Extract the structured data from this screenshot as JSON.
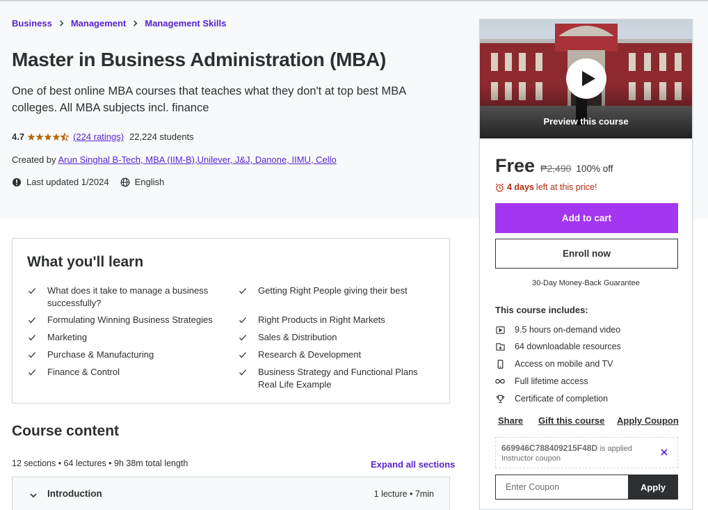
{
  "breadcrumb": [
    "Business",
    "Management",
    "Management Skills"
  ],
  "course": {
    "title": "Master in Business Administration (MBA)",
    "subtitle": "One of best online MBA courses that teaches what they don't at top best MBA colleges. All MBA subjects incl. finance",
    "rating": "4.7",
    "rating_value": 4.7,
    "rating_max": 5,
    "ratings_count": "(224 ratings)",
    "students": "22,224 students",
    "created_by_label": "Created by",
    "instructor": "Arun Singhal B-Tech, MBA (IIM-B),Unilever, J&J, Danone, IIMU, Cello",
    "last_updated": "Last updated 1/2024",
    "language": "English"
  },
  "learn": {
    "title": "What you'll learn",
    "items_left": [
      "What does it take to manage a business successfully?",
      "Formulating Winning Business Strategies",
      "Marketing",
      "Purchase & Manufacturing",
      "Finance & Control"
    ],
    "items_right": [
      "Getting Right People giving their best",
      "Right Products in Right Markets",
      "Sales & Distribution",
      "Research & Development",
      "Business Strategy and Functional Plans Real Life Example"
    ]
  },
  "content": {
    "title": "Course content",
    "meta": "12 sections • 64 lectures • 9h 38m total length",
    "expand_label": "Expand all sections",
    "sections": [
      {
        "title": "Introduction",
        "meta": "1 lecture • 7min"
      }
    ]
  },
  "sidebar": {
    "preview_label": "Preview this course",
    "price": "Free",
    "original_price": "₱2,490",
    "discount": "100% off",
    "deadline_bold": "4 days",
    "deadline_rest": "left at this price!",
    "add_to_cart": "Add to cart",
    "enroll": "Enroll now",
    "guarantee": "30-Day Money-Back Guarantee",
    "includes_title": "This course includes:",
    "includes": [
      {
        "icon": "video-icon",
        "text": "9.5 hours on-demand video"
      },
      {
        "icon": "download-icon",
        "text": "64 downloadable resources"
      },
      {
        "icon": "mobile-icon",
        "text": "Access on mobile and TV"
      },
      {
        "icon": "infinity-icon",
        "text": "Full lifetime access"
      },
      {
        "icon": "trophy-icon",
        "text": "Certificate of completion"
      }
    ],
    "links": [
      "Share",
      "Gift this course",
      "Apply Coupon"
    ],
    "coupon_code": "669946C788409215F48D",
    "coupon_applied": "is applied",
    "coupon_type": "Instructor coupon",
    "coupon_placeholder": "Enter Coupon",
    "apply_label": "Apply"
  },
  "colors": {
    "accent": "#a435f0",
    "link": "#5624d0",
    "star": "#b4690e",
    "deadline": "#b32d0f",
    "text": "#2d2f31"
  }
}
